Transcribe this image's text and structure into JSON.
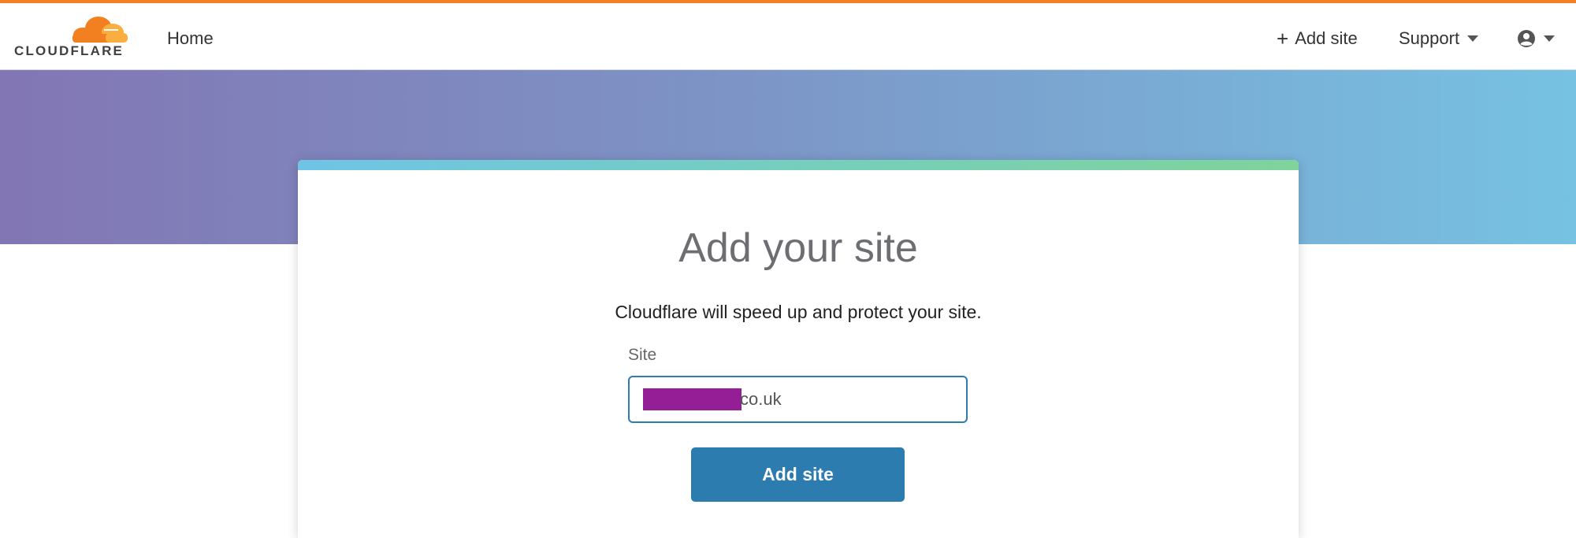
{
  "header": {
    "logo_text": "CLOUDFLARE",
    "logo_icon": "cloudflare-cloud-logo",
    "nav_home": "Home",
    "add_site_icon": "plus-icon",
    "nav_add_site": "Add site",
    "nav_support": "Support",
    "account_icon": "user-circle-icon",
    "accent_color": "#f38020"
  },
  "card": {
    "title": "Add your site",
    "subtitle": "Cloudflare will speed up and protect your site.",
    "site_label": "Site",
    "site_value": "co.uk",
    "submit_label": "Add site",
    "button_color": "#2c7cb0"
  }
}
